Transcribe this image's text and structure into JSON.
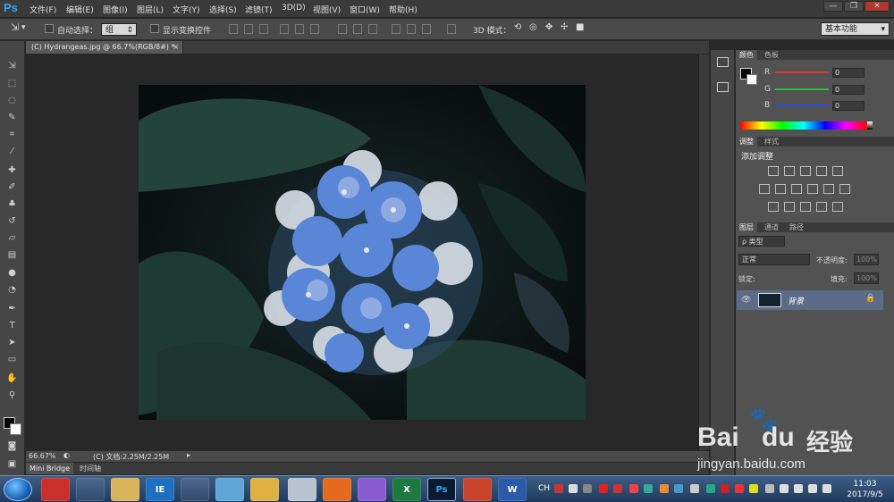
{
  "app": {
    "logo": "Ps",
    "window_controls": [
      "—",
      "❐",
      "✕"
    ]
  },
  "menu": [
    "文件(F)",
    "编辑(E)",
    "图像(I)",
    "图层(L)",
    "文字(Y)",
    "选择(S)",
    "滤镜(T)",
    "3D(D)",
    "视图(V)",
    "窗口(W)",
    "帮助(H)"
  ],
  "options": {
    "auto_select_label": "自动选择：",
    "auto_select_value": "组",
    "show_transform_label": "显示变换控件",
    "mode_3d_label": "3D 模式：",
    "workspace": "基本功能"
  },
  "document": {
    "tab_title": "(C) Hydrangeas.jpg @ 66.7%(RGB/8#) *",
    "close": "×",
    "zoom": "66.67%",
    "doc_info": "(C) 文档:2.25M/2.25M"
  },
  "bottom_tabs": [
    "Mini Bridge",
    "时间轴"
  ],
  "color_panel": {
    "tabs": [
      "颜色",
      "色板"
    ],
    "channels": [
      {
        "label": "R",
        "value": "0",
        "color": "#e23232"
      },
      {
        "label": "G",
        "value": "0",
        "color": "#2fbf3a"
      },
      {
        "label": "B",
        "value": "0",
        "color": "#2f47e2"
      }
    ]
  },
  "adjust_panel": {
    "tabs": [
      "调整",
      "样式"
    ],
    "title": "添加调整"
  },
  "layers_panel": {
    "tabs": [
      "图层",
      "通道",
      "路径"
    ],
    "filter_label": "ρ 类型",
    "blend_mode": "正常",
    "opacity_label": "不透明度:",
    "opacity_value": "100%",
    "lock_label": "锁定:",
    "fill_label": "填充:",
    "fill_value": "100%",
    "layer_name": "背景"
  },
  "taskbar": {
    "apps": [
      "IE",
      "Ps",
      "W",
      "X"
    ],
    "tray_lang": "CH",
    "time": "11:03",
    "date": "2017/9/5"
  },
  "watermark": {
    "brand": "Bai",
    "brand2": "du",
    "brand_cn": "经验",
    "url": "jingyan.baidu.com"
  },
  "colors": {
    "accent": "#31a8ff",
    "layer_selected": "#5b6b88",
    "flower": "#5a86d8"
  }
}
